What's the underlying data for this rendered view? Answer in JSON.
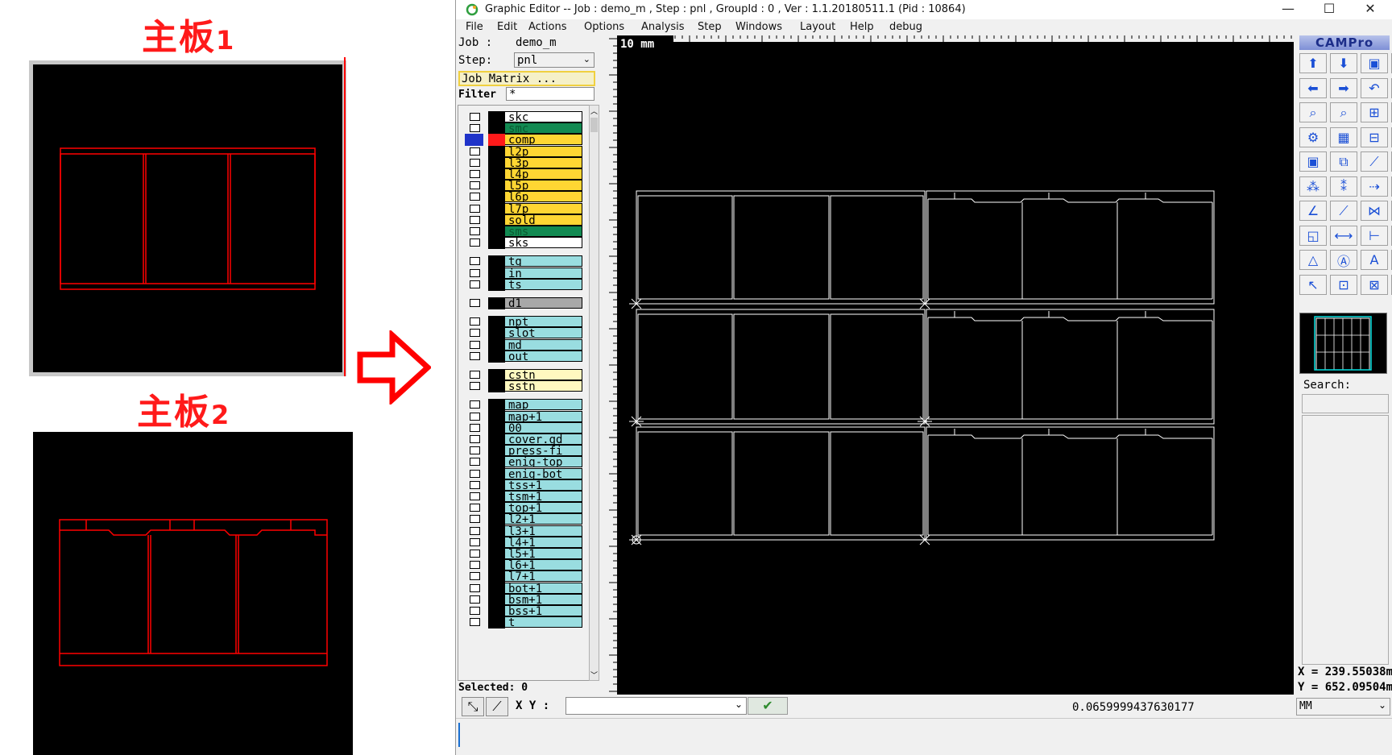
{
  "illustration": {
    "board1_label": "主板",
    "board1_num": "1",
    "board2_label": "主板",
    "board2_num": "2"
  },
  "window": {
    "title": "Graphic Editor -- Job : demo_m , Step : pnl , GroupId : 0 , Ver : 1.1.20180511.1 (Pid : 10864)",
    "minimize": "—",
    "maximize": "☐",
    "close": "✕"
  },
  "menu": [
    "File",
    "Edit",
    "Actions",
    "Options",
    "Analysis",
    "Step",
    "Windows",
    "Layout",
    "Help",
    "debug"
  ],
  "job": {
    "label": "Job  :",
    "value": "demo_m"
  },
  "step": {
    "label": "Step:",
    "value": "pnl"
  },
  "job_matrix_label": "Job Matrix ...",
  "filter": {
    "label": "Filter",
    "value": "*"
  },
  "colors": {
    "yellow": "#ffd633",
    "green": "#128a52",
    "cyan": "#99dde0",
    "white": "#ffffff",
    "gray": "#a8a8a8",
    "lightyellow": "#fff8c0",
    "board_red": "#ff0000"
  },
  "layers": [
    {
      "name": "skc",
      "color": "white"
    },
    {
      "name": "smc",
      "color": "green"
    },
    {
      "name": "comp",
      "color": "yellow",
      "active": true
    },
    {
      "name": "l2p",
      "color": "yellow"
    },
    {
      "name": "l3p",
      "color": "yellow"
    },
    {
      "name": "l4p",
      "color": "yellow"
    },
    {
      "name": "l5p",
      "color": "yellow"
    },
    {
      "name": "l6p",
      "color": "yellow"
    },
    {
      "name": "l7p",
      "color": "yellow"
    },
    {
      "name": "sold",
      "color": "yellow"
    },
    {
      "name": "sms",
      "color": "green"
    },
    {
      "name": "sks",
      "color": "white"
    },
    {
      "name": "tg",
      "color": "cyan"
    },
    {
      "name": "in",
      "color": "cyan"
    },
    {
      "name": "ts",
      "color": "cyan"
    },
    {
      "name": "d1",
      "color": "gray"
    },
    {
      "name": "npt",
      "color": "cyan"
    },
    {
      "name": "slot",
      "color": "cyan"
    },
    {
      "name": "md",
      "color": "cyan"
    },
    {
      "name": "out",
      "color": "cyan"
    },
    {
      "name": "cstn",
      "color": "lightyellow"
    },
    {
      "name": "sstn",
      "color": "lightyellow"
    },
    {
      "name": "map",
      "color": "cyan"
    },
    {
      "name": "map+1",
      "color": "cyan"
    },
    {
      "name": "00",
      "color": "cyan"
    },
    {
      "name": "cover.gd",
      "color": "cyan"
    },
    {
      "name": "press-fi",
      "color": "cyan"
    },
    {
      "name": "enig-top",
      "color": "cyan"
    },
    {
      "name": "enig-bot",
      "color": "cyan"
    },
    {
      "name": "tss+1",
      "color": "cyan"
    },
    {
      "name": "tsm+1",
      "color": "cyan"
    },
    {
      "name": "top+1",
      "color": "cyan"
    },
    {
      "name": "l2+1",
      "color": "cyan"
    },
    {
      "name": "l3+1",
      "color": "cyan"
    },
    {
      "name": "l4+1",
      "color": "cyan"
    },
    {
      "name": "l5+1",
      "color": "cyan"
    },
    {
      "name": "l6+1",
      "color": "cyan"
    },
    {
      "name": "l7+1",
      "color": "cyan"
    },
    {
      "name": "bot+1",
      "color": "cyan"
    },
    {
      "name": "bsm+1",
      "color": "cyan"
    },
    {
      "name": "bss+1",
      "color": "cyan"
    },
    {
      "name": "t",
      "color": "cyan"
    }
  ],
  "selected": "Selected: 0",
  "canvas": {
    "scale_label": "10 mm"
  },
  "brand": "CAMPro",
  "search_label": "Search:",
  "coords": {
    "x": "X = 239.55038mm",
    "y": "Y = 652.09504mm"
  },
  "bottom": {
    "xy_label": "X  Y :",
    "xy_value": "",
    "readout": "0.0659999437630177",
    "units": "MM"
  },
  "toolbar_icons": [
    "arrow-up-icon",
    "arrow-down-icon",
    "frame-icon",
    "frame-alt-icon",
    "arrow-left-icon",
    "arrow-right-icon",
    "undo-icon",
    "scroll-icon",
    "zoom-icon",
    "zoom-area-icon",
    "measure-xy-icon",
    "help-icon",
    "gear-icon",
    "grid-icon",
    "snap-icon",
    "snap-alt-icon",
    "screenshot-icon",
    "copy-icon",
    "edit-line-icon",
    "fit-icon",
    "add-pad-icon",
    "delete-pad-icon",
    "move-icon",
    "connect-icon",
    "angle-icon",
    "slash-icon",
    "mirror-icon",
    "erase-icon",
    "select-box-icon",
    "horizontal-icon",
    "measure-icon",
    "group-icon",
    "triangle-icon",
    "text-a-icon",
    "text-a-alt-icon",
    "arc-icon",
    "pointer-icon",
    "select-rect-icon",
    "cross-select-icon",
    "nodes-icon"
  ],
  "toolbar_glyphs": [
    "⬆",
    "⬇",
    "▣",
    "▭",
    "⬅",
    "➡",
    "↶",
    "⇌",
    "⌕",
    "⌕",
    "⊞",
    "?",
    "⚙",
    "▦",
    "⊟",
    "⊠",
    "▣",
    "⧉",
    "⟋",
    "◙",
    "⁂",
    "⁑",
    "⇢",
    "⚯",
    "∠",
    "⟋",
    "⋈",
    "●",
    "◱",
    "⟷",
    "⊢",
    "⧠",
    "△",
    "Ⓐ",
    "A",
    "⌒",
    "↖",
    "⊡",
    "⊠",
    "⋰"
  ]
}
